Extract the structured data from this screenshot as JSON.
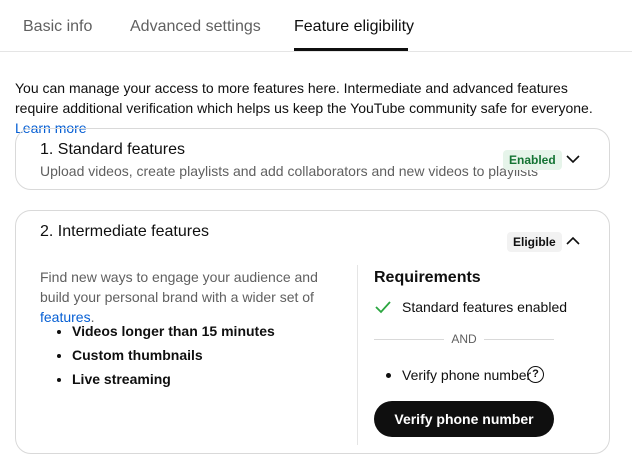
{
  "tabs": [
    {
      "label": "Basic info"
    },
    {
      "label": "Advanced settings"
    },
    {
      "label": "Feature eligibility"
    }
  ],
  "intro": {
    "text": "You can manage your access to more features here. Intermediate and advanced features require additional verification which helps us keep the YouTube community safe for everyone.",
    "link": "Learn more"
  },
  "standard": {
    "title": "1. Standard features",
    "subtitle": "Upload videos, create playlists and add collaborators and new videos to playlists",
    "badge": "Enabled",
    "chevron_icon": "chevron-down-icon"
  },
  "intermediate": {
    "title": "2. Intermediate features",
    "badge": "Eligible",
    "chevron_icon": "chevron-up-icon",
    "description": "Find new ways to engage your audience and build your personal brand with a wider set of",
    "description_link": "features",
    "description_end": ".",
    "features": [
      "Videos longer than 15 minutes",
      "Custom thumbnails",
      "Live streaming"
    ],
    "requirements": {
      "title": "Requirements",
      "met": "Standard features enabled",
      "separator": "AND",
      "pending": "Verify phone number",
      "help_glyph": "?",
      "button": "Verify phone number"
    }
  },
  "colors": {
    "enabled_badge_bg": "#e6f4ea",
    "enabled_badge_text": "#137333",
    "link": "#065fd4",
    "check": "#2ba640",
    "button_bg": "#0f0f0f"
  }
}
